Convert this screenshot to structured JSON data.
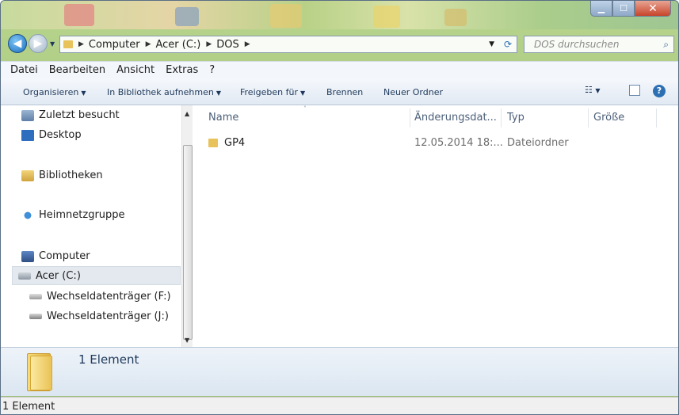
{
  "address": {
    "segments": [
      "Computer",
      "Acer (C:)",
      "DOS"
    ]
  },
  "search": {
    "placeholder": "DOS durchsuchen"
  },
  "menu": {
    "items": [
      "Datei",
      "Bearbeiten",
      "Ansicht",
      "Extras",
      "?"
    ]
  },
  "toolbar": {
    "organize": "Organisieren",
    "library": "In Bibliothek aufnehmen",
    "share": "Freigeben für",
    "burn": "Brennen",
    "new_folder": "Neuer Ordner"
  },
  "nav": {
    "items": [
      {
        "label": "Zuletzt besucht",
        "icon": "recent-places-icon"
      },
      {
        "label": "Desktop",
        "icon": "desktop-icon"
      },
      {
        "label": "Bibliotheken",
        "icon": "libraries-icon"
      },
      {
        "label": "Heimnetzgruppe",
        "icon": "homegroup-icon"
      },
      {
        "label": "Computer",
        "icon": "computer-icon"
      },
      {
        "label": "Acer (C:)",
        "icon": "hard-drive-icon"
      },
      {
        "label": "Wechseldatenträger (F:)",
        "icon": "removable-drive-icon"
      },
      {
        "label": "Wechseldatenträger (J:)",
        "icon": "removable-drive-icon"
      }
    ],
    "selected": "Acer (C:)"
  },
  "columns": {
    "name": "Name",
    "modified": "Änderungsdat...",
    "type": "Typ",
    "size": "Größe"
  },
  "files": [
    {
      "name": "GP4",
      "modified": "12.05.2014 18:...",
      "type": "Dateiordner",
      "size": ""
    }
  ],
  "details": {
    "count": "1 Element"
  },
  "status": {
    "text": "1 Element"
  },
  "colors": {
    "accent": "#1e395b",
    "selection": "#e4e9ef",
    "folder": "#e8c25b"
  }
}
